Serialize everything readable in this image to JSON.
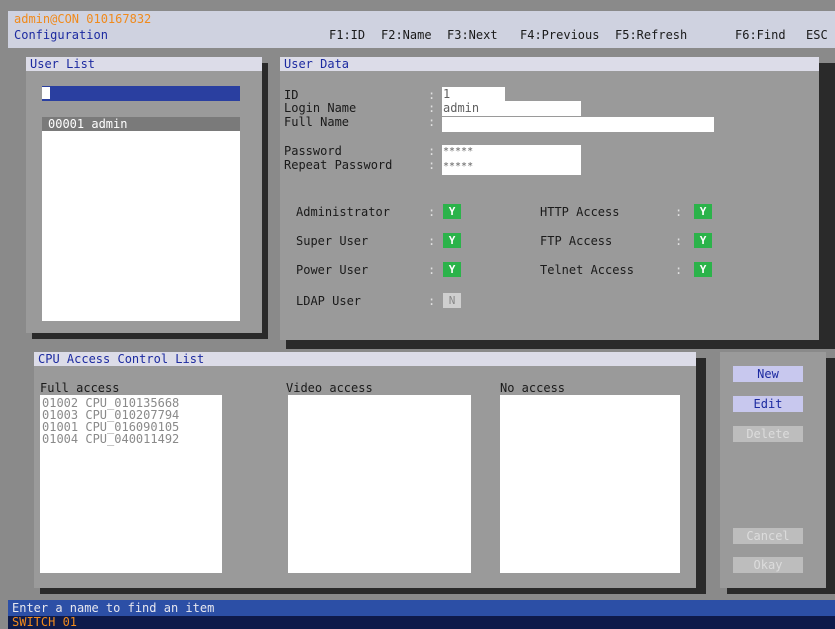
{
  "header": {
    "user": "admin@CON 010167832",
    "menu_title": "Configuration",
    "fkeys": [
      "F1:ID",
      "F2:Name",
      "F3:Next",
      "F4:Previous",
      "F5:Refresh",
      "F6:Find",
      "ESC"
    ]
  },
  "user_list": {
    "title": "User List",
    "search_value": "",
    "items": [
      "00001 admin"
    ]
  },
  "user_data": {
    "title": "User Data",
    "id_label": "ID",
    "id_value": "1",
    "login_label": "Login Name",
    "login_value": "admin",
    "fullname_label": "Full Name",
    "fullname_value": "",
    "password_label": "Password",
    "password_value": "*****",
    "repeat_label": "Repeat Password",
    "repeat_value": "*****",
    "colon": ":",
    "flags_left": [
      {
        "label": "Administrator",
        "value": "Y"
      },
      {
        "label": "Super User",
        "value": "Y"
      },
      {
        "label": "Power User",
        "value": "Y"
      },
      {
        "label": "LDAP User",
        "value": "N"
      }
    ],
    "flags_right": [
      {
        "label": "HTTP Access",
        "value": "Y"
      },
      {
        "label": "FTP Access",
        "value": "Y"
      },
      {
        "label": "Telnet Access",
        "value": "Y"
      }
    ]
  },
  "cpu_acl": {
    "title": "CPU Access Control List",
    "full_label": "Full access",
    "video_label": "Video access",
    "none_label": "No access",
    "full_items": [
      "01002 CPU_010135668",
      "01003 CPU_010207794",
      "01001 CPU_016090105",
      "01004 CPU_040011492"
    ]
  },
  "buttons": {
    "new": "New",
    "edit": "Edit",
    "delete": "Delete",
    "cancel": "Cancel",
    "okay": "Okay"
  },
  "status": {
    "message": "Enter a name to find an item",
    "switch": "SWITCH 01"
  },
  "colors": {
    "accent_blue": "#1c2aa0",
    "flag_green": "#2bb34a",
    "status_bar": "#2c4fa6",
    "orange": "#f08a1c"
  }
}
